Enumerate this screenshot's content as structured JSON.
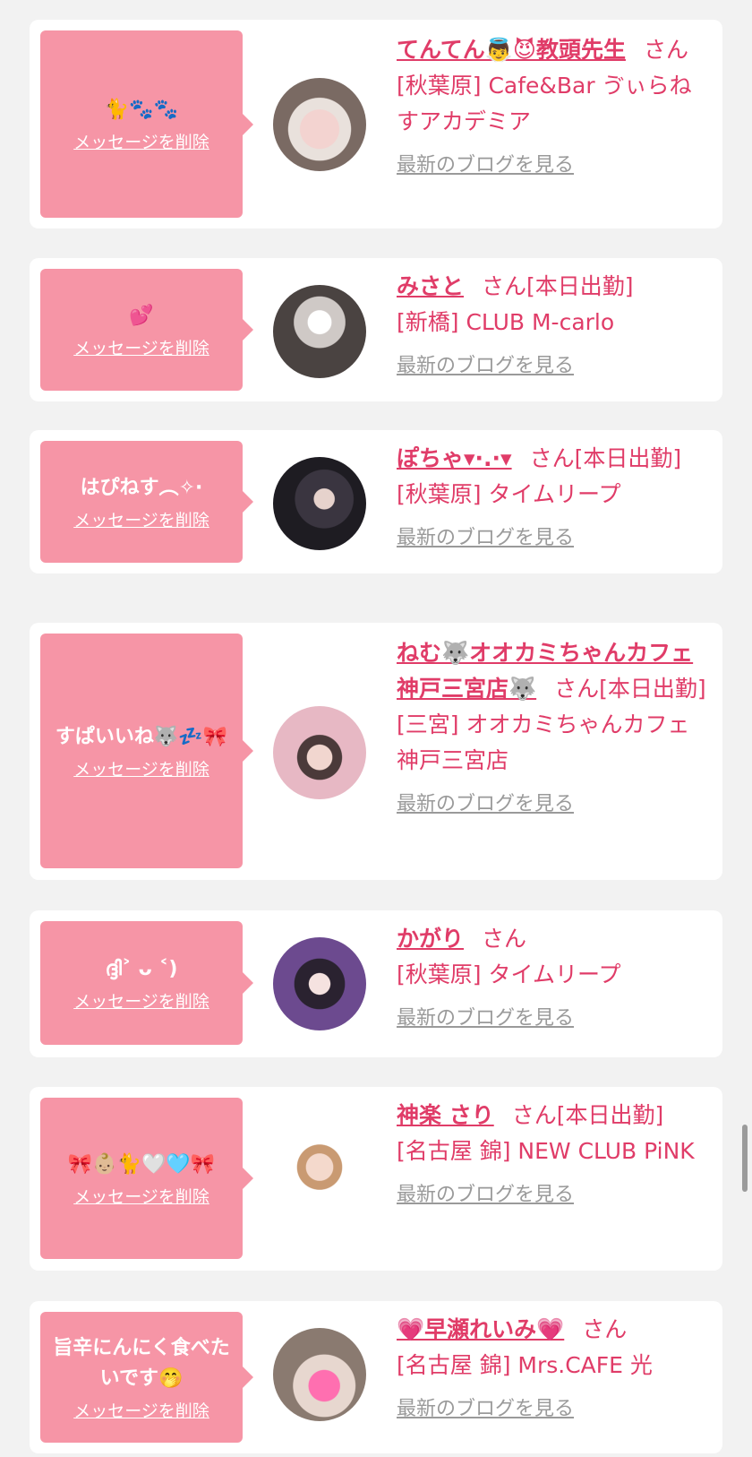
{
  "delete_label": "メッセージを削除",
  "blog_label": "最新のブログを見る",
  "san_label": "さん",
  "items": [
    {
      "message": "🐈🐾🐾",
      "name": "てんてん👼😈教頭先生",
      "status": "",
      "shop": "[秋葉原] Cafe&Bar ゔぃらねすアカデミア"
    },
    {
      "message": "💕",
      "name": "みさと",
      "status": "[本日出勤]",
      "shop": "[新橋] CLUB M-carlo"
    },
    {
      "message": "はぴねす︵✧·",
      "name": "ぽちゃ▾·.·▾",
      "status": "[本日出勤]",
      "shop": "[秋葉原] タイムリープ"
    },
    {
      "message": "すぱいいね🐺💤🎀",
      "name": "ねむ🐺オオカミちゃんカフェ神戸三宮店🐺",
      "status": "[本日出勤]",
      "shop": "[三宮] オオカミちゃんカフェ神戸三宮店"
    },
    {
      "message": "ദ്ദി˃ ᴗ ˂)",
      "name": "かがり",
      "status": "",
      "shop": "[秋葉原] タイムリープ"
    },
    {
      "message": "🎀👶🏼🐈🤍🩵🎀",
      "name": "神楽 さり",
      "status": "[本日出勤]",
      "shop": "[名古屋 錦] NEW CLUB PiNK"
    },
    {
      "message": "旨辛にんにく食べたいです🤭",
      "name": "💗早瀬れいみ💗",
      "status": "",
      "shop": "[名古屋 錦] Mrs.CAFE 光"
    }
  ]
}
